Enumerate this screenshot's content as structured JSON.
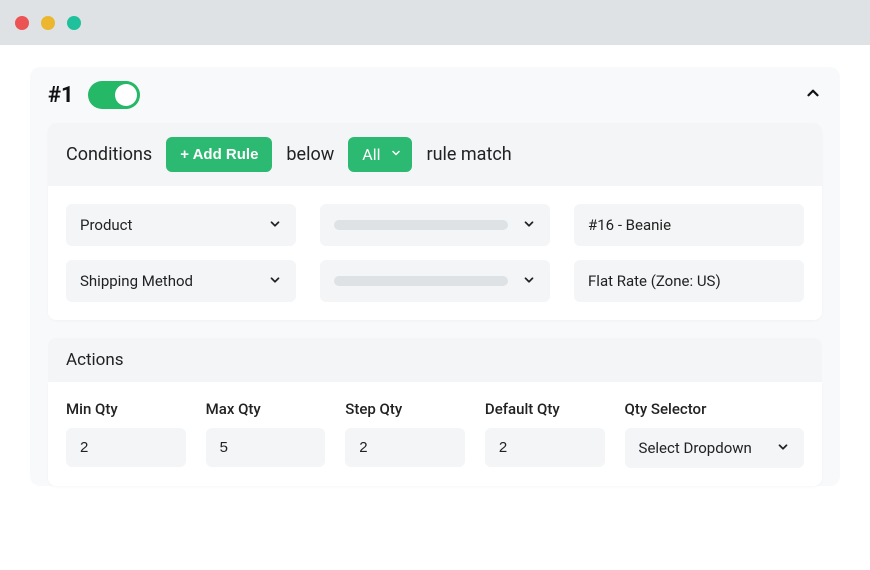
{
  "rule": {
    "number": "#1",
    "enabled": true
  },
  "conditions": {
    "heading": "Conditions",
    "add_rule_label": "+ Add Rule",
    "text_below": "below",
    "match_selector": "All",
    "text_rule_match": "rule match",
    "rows": [
      {
        "type": "Product",
        "value": "#16 - Beanie"
      },
      {
        "type": "Shipping Method",
        "value": "Flat Rate (Zone: US)"
      }
    ]
  },
  "actions": {
    "heading": "Actions",
    "min_qty": {
      "label": "Min Qty",
      "value": "2"
    },
    "max_qty": {
      "label": "Max Qty",
      "value": "5"
    },
    "step_qty": {
      "label": "Step Qty",
      "value": "2"
    },
    "default_qty": {
      "label": "Default Qty",
      "value": "2"
    },
    "qty_selector": {
      "label": "Qty Selector",
      "value": "Select Dropdown"
    }
  }
}
